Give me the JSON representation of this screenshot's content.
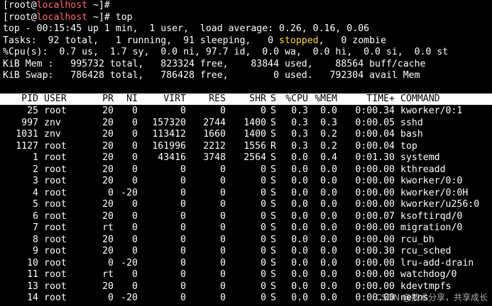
{
  "prompt": {
    "line1_user": "[root@",
    "line1_host": "localhost",
    "line1_rest": " ~]#",
    "line2_user": "[root@",
    "line2_host": "localhost",
    "line2_rest": " ~]# top"
  },
  "summary": {
    "uptime_line": "top - 00:15:45 up 1 min,  1 user,  load average: 0.26, 0.16, 0.06",
    "tasks_prefix": "Tasks:  92 total,   1 running,  91 sleeping,   0 ",
    "tasks_stopped": "stopped",
    "tasks_suffix": ",   0 zombie",
    "cpu_line": "%Cpu(s):  0.7 us,  1.7 sy,  0.0 ni, 97.7 id,  0.0 wa,  0.0 hi,  0.0 si,  0.0 st",
    "mem_line": "KiB Mem :   995732 total,   823324 free,    83844 used,    88564 buff/cache",
    "swap_line": "KiB Swap:   786428 total,   786428 free,        0 used.   792304 avail Mem"
  },
  "table": {
    "headers": {
      "pid": "PID",
      "user": "USER",
      "pr": "PR",
      "ni": "NI",
      "virt": "VIRT",
      "res": "RES",
      "shr": "SHR",
      "s": "S",
      "cpu": "%CPU",
      "mem": "%MEM",
      "time": "TIME+",
      "command": "COMMAND"
    },
    "rows": [
      {
        "pid": "25",
        "user": "root",
        "pr": "20",
        "ni": "0",
        "virt": "0",
        "res": "0",
        "shr": "0",
        "s": "S",
        "cpu": "0.3",
        "mem": "0.0",
        "time": "0:00.34",
        "command": "kworker/0:1"
      },
      {
        "pid": "997",
        "user": "znv",
        "pr": "20",
        "ni": "0",
        "virt": "157320",
        "res": "2744",
        "shr": "1400",
        "s": "S",
        "cpu": "0.3",
        "mem": "0.3",
        "time": "0:00.05",
        "command": "sshd"
      },
      {
        "pid": "1031",
        "user": "znv",
        "pr": "20",
        "ni": "0",
        "virt": "113412",
        "res": "1660",
        "shr": "1400",
        "s": "S",
        "cpu": "0.3",
        "mem": "0.2",
        "time": "0:00.04",
        "command": "bash"
      },
      {
        "pid": "1127",
        "user": "root",
        "pr": "20",
        "ni": "0",
        "virt": "161996",
        "res": "2212",
        "shr": "1556",
        "s": "R",
        "cpu": "0.3",
        "mem": "0.2",
        "time": "0:00.04",
        "command": "top"
      },
      {
        "pid": "1",
        "user": "root",
        "pr": "20",
        "ni": "0",
        "virt": "43416",
        "res": "3748",
        "shr": "2564",
        "s": "S",
        "cpu": "0.0",
        "mem": "0.4",
        "time": "0:01.30",
        "command": "systemd"
      },
      {
        "pid": "2",
        "user": "root",
        "pr": "20",
        "ni": "0",
        "virt": "0",
        "res": "0",
        "shr": "0",
        "s": "S",
        "cpu": "0.0",
        "mem": "0.0",
        "time": "0:00.00",
        "command": "kthreadd"
      },
      {
        "pid": "3",
        "user": "root",
        "pr": "20",
        "ni": "0",
        "virt": "0",
        "res": "0",
        "shr": "0",
        "s": "S",
        "cpu": "0.0",
        "mem": "0.0",
        "time": "0:00.00",
        "command": "kworker/0:0"
      },
      {
        "pid": "4",
        "user": "root",
        "pr": "0",
        "ni": "-20",
        "virt": "0",
        "res": "0",
        "shr": "0",
        "s": "S",
        "cpu": "0.0",
        "mem": "0.0",
        "time": "0:00.00",
        "command": "kworker/0:0H"
      },
      {
        "pid": "5",
        "user": "root",
        "pr": "20",
        "ni": "0",
        "virt": "0",
        "res": "0",
        "shr": "0",
        "s": "S",
        "cpu": "0.0",
        "mem": "0.0",
        "time": "0:00.00",
        "command": "kworker/u256:0"
      },
      {
        "pid": "6",
        "user": "root",
        "pr": "20",
        "ni": "0",
        "virt": "0",
        "res": "0",
        "shr": "0",
        "s": "S",
        "cpu": "0.0",
        "mem": "0.0",
        "time": "0:00.07",
        "command": "ksoftirqd/0"
      },
      {
        "pid": "7",
        "user": "root",
        "pr": "rt",
        "ni": "0",
        "virt": "0",
        "res": "0",
        "shr": "0",
        "s": "S",
        "cpu": "0.0",
        "mem": "0.0",
        "time": "0:00.00",
        "command": "migration/0"
      },
      {
        "pid": "8",
        "user": "root",
        "pr": "20",
        "ni": "0",
        "virt": "0",
        "res": "0",
        "shr": "0",
        "s": "S",
        "cpu": "0.0",
        "mem": "0.0",
        "time": "0:00.00",
        "command": "rcu_bh"
      },
      {
        "pid": "9",
        "user": "root",
        "pr": "20",
        "ni": "0",
        "virt": "0",
        "res": "0",
        "shr": "0",
        "s": "S",
        "cpu": "0.0",
        "mem": "0.0",
        "time": "0:00.30",
        "command": "rcu_sched"
      },
      {
        "pid": "10",
        "user": "root",
        "pr": "0",
        "ni": "-20",
        "virt": "0",
        "res": "0",
        "shr": "0",
        "s": "S",
        "cpu": "0.0",
        "mem": "0.0",
        "time": "0:00.00",
        "command": "lru-add-drain"
      },
      {
        "pid": "11",
        "user": "root",
        "pr": "rt",
        "ni": "0",
        "virt": "0",
        "res": "0",
        "shr": "0",
        "s": "S",
        "cpu": "0.0",
        "mem": "0.0",
        "time": "0:00.00",
        "command": "watchdog/0"
      },
      {
        "pid": "13",
        "user": "root",
        "pr": "20",
        "ni": "0",
        "virt": "0",
        "res": "0",
        "shr": "0",
        "s": "S",
        "cpu": "0.0",
        "mem": "0.0",
        "time": "0:00.00",
        "command": "kdevtmpfs"
      },
      {
        "pid": "14",
        "user": "root",
        "pr": "0",
        "ni": "-20",
        "virt": "0",
        "res": "0",
        "shr": "0",
        "s": "S",
        "cpu": "0.0",
        "mem": "0.0",
        "time": "0:00.00",
        "command": "netns"
      }
    ]
  },
  "watermark": "CSDN @技术分享，共享成长",
  "colors": {
    "background": "#000000",
    "text": "#ffffff",
    "hostname": "#ff6b6b",
    "stopped": "#ffd84a",
    "header_bar": "#ffffff",
    "header_text": "#000000"
  }
}
